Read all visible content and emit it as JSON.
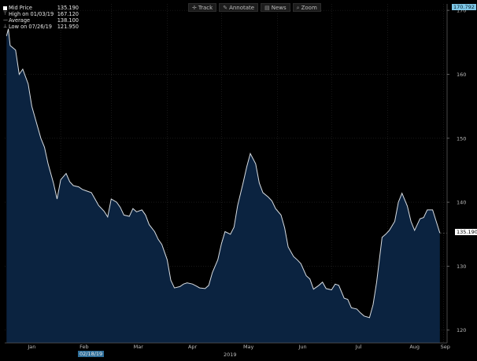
{
  "toolbar": {
    "items": [
      {
        "label": "Track",
        "icon": "track-icon"
      },
      {
        "label": "Annotate",
        "icon": "annotate-icon"
      },
      {
        "label": "News",
        "icon": "news-icon"
      },
      {
        "label": "Zoom",
        "icon": "zoom-icon"
      }
    ]
  },
  "legend": {
    "rows": [
      {
        "label": "Mid Price",
        "value": "135.190",
        "icon": "square-icon"
      },
      {
        "label": "High on 01/03/19",
        "value": "167.120",
        "icon": "arrow-up-icon"
      },
      {
        "label": "Average",
        "value": "138.100",
        "icon": "dash-icon"
      },
      {
        "label": "Low on 07/26/19",
        "value": "121.950",
        "icon": "arrow-down-icon"
      }
    ]
  },
  "badges": {
    "top_price": "170.792",
    "last_price": "135.190",
    "date": "02/18/19",
    "year": "2019"
  },
  "colors": {
    "background": "#000000",
    "area_fill": "#0b2340",
    "line": "#d8dde2",
    "grid": "#2a2a2a"
  },
  "chart_data": {
    "type": "area",
    "x_tick_labels": [
      "Jan",
      "Feb",
      "Mar",
      "Apr",
      "May",
      "Jun",
      "Jul",
      "Aug",
      "Sep"
    ],
    "y_tick_labels": [
      "120",
      "130",
      "140",
      "150",
      "160",
      "170"
    ],
    "ylim": [
      118,
      171
    ],
    "grid": true,
    "series": [
      {
        "x": [
          "2019-01-02",
          "2019-01-03",
          "2019-01-04",
          "2019-01-07",
          "2019-01-09",
          "2019-01-11",
          "2019-01-14",
          "2019-01-16",
          "2019-01-18",
          "2019-01-21",
          "2019-01-23",
          "2019-01-25",
          "2019-01-28",
          "2019-01-30",
          "2019-02-01",
          "2019-02-04",
          "2019-02-06",
          "2019-02-08",
          "2019-02-11",
          "2019-02-13",
          "2019-02-15",
          "2019-02-18",
          "2019-02-20",
          "2019-02-22",
          "2019-02-25",
          "2019-02-27",
          "2019-03-01",
          "2019-03-04",
          "2019-03-06",
          "2019-03-08",
          "2019-03-11",
          "2019-03-13",
          "2019-03-15",
          "2019-03-18",
          "2019-03-20",
          "2019-03-22",
          "2019-03-25",
          "2019-03-27",
          "2019-03-29",
          "2019-04-01",
          "2019-04-03",
          "2019-04-05",
          "2019-04-08",
          "2019-04-10",
          "2019-04-12",
          "2019-04-15",
          "2019-04-17",
          "2019-04-19",
          "2019-04-22",
          "2019-04-24",
          "2019-04-26",
          "2019-04-29",
          "2019-05-01",
          "2019-05-03",
          "2019-05-06",
          "2019-05-08",
          "2019-05-10",
          "2019-05-13",
          "2019-05-15",
          "2019-05-17",
          "2019-05-20",
          "2019-05-22",
          "2019-05-24",
          "2019-05-27",
          "2019-05-29",
          "2019-05-31",
          "2019-06-03",
          "2019-06-05",
          "2019-06-07",
          "2019-06-10",
          "2019-06-12",
          "2019-06-14",
          "2019-06-17",
          "2019-06-19",
          "2019-06-21",
          "2019-06-24",
          "2019-06-26",
          "2019-06-28",
          "2019-07-01",
          "2019-07-03",
          "2019-07-05",
          "2019-07-08",
          "2019-07-10",
          "2019-07-12",
          "2019-07-15",
          "2019-07-17",
          "2019-07-19",
          "2019-07-22",
          "2019-07-24",
          "2019-07-26",
          "2019-07-29",
          "2019-07-31",
          "2019-08-02",
          "2019-08-05",
          "2019-08-07",
          "2019-08-09",
          "2019-08-12",
          "2019-08-14",
          "2019-08-16",
          "2019-08-19",
          "2019-08-21",
          "2019-08-23",
          "2019-08-26",
          "2019-08-28",
          "2019-08-30"
        ],
        "values": [
          166.0,
          167.1,
          164.5,
          163.8,
          160.0,
          160.8,
          158.5,
          155.0,
          153.0,
          150.0,
          148.6,
          146.0,
          143.0,
          140.5,
          143.5,
          144.5,
          143.2,
          142.6,
          142.4,
          142.0,
          141.8,
          141.5,
          140.5,
          139.5,
          138.6,
          137.7,
          140.5,
          140.0,
          139.2,
          138.0,
          137.8,
          139.0,
          138.5,
          138.8,
          138.0,
          136.5,
          135.4,
          134.2,
          133.4,
          131.0,
          127.8,
          126.6,
          126.8,
          127.2,
          127.4,
          127.2,
          126.9,
          126.6,
          126.5,
          127.0,
          129.0,
          131.0,
          133.5,
          135.4,
          135.0,
          136.1,
          139.5,
          143.0,
          145.5,
          147.6,
          146.0,
          143.0,
          141.5,
          140.8,
          140.2,
          139.0,
          138.0,
          136.0,
          133.0,
          131.5,
          131.0,
          130.4,
          128.5,
          128.0,
          126.4,
          127.0,
          127.5,
          126.5,
          126.3,
          127.2,
          127.0,
          125.0,
          124.8,
          123.5,
          123.3,
          122.7,
          122.2,
          121.95,
          124.0,
          127.5,
          134.5,
          135.0,
          135.6,
          137.0,
          140.0,
          141.4,
          139.4,
          137.0,
          135.6,
          137.4,
          137.6,
          138.8,
          138.8,
          137.0,
          135.19
        ]
      }
    ]
  }
}
